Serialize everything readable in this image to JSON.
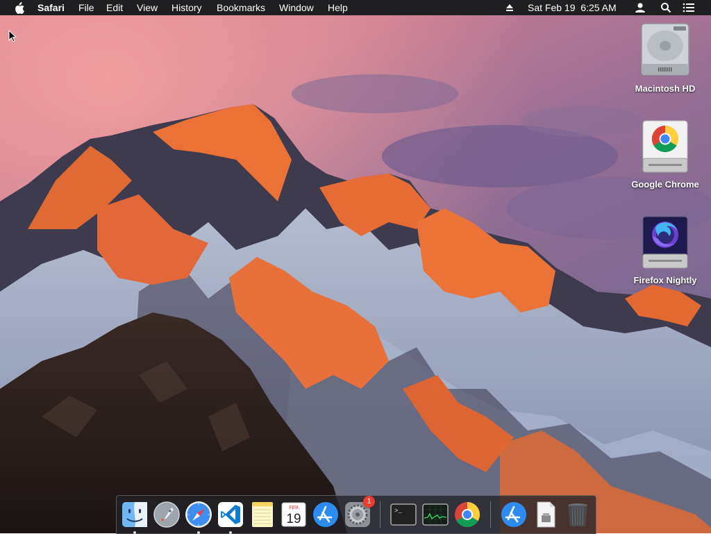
{
  "menubar": {
    "app_name": "Safari",
    "menus": [
      "File",
      "Edit",
      "View",
      "History",
      "Bookmarks",
      "Window",
      "Help"
    ],
    "datetime": "Sat Feb 19  6:25 AM",
    "status_icons": [
      "eject-icon",
      "user-icon",
      "spotlight-search-icon",
      "notification-center-icon"
    ]
  },
  "desktop": {
    "icons": [
      {
        "label": "Macintosh HD",
        "icon": "hard-drive-icon"
      },
      {
        "label": "Google Chrome",
        "icon": "chrome-volume-icon"
      },
      {
        "label": "Firefox Nightly",
        "icon": "firefox-nightly-volume-icon"
      }
    ]
  },
  "dock": {
    "apps": [
      {
        "name": "Finder",
        "icon": "finder-icon",
        "running": true
      },
      {
        "name": "Launchpad",
        "icon": "launchpad-icon",
        "running": false
      },
      {
        "name": "Safari",
        "icon": "safari-icon",
        "running": true
      },
      {
        "name": "Visual Studio Code",
        "icon": "vscode-icon",
        "running": true
      },
      {
        "name": "Notes",
        "icon": "notes-icon",
        "running": false
      },
      {
        "name": "Calendar",
        "icon": "calendar-icon",
        "running": false,
        "calendar_month": "FEB",
        "calendar_day": "19"
      },
      {
        "name": "App Store",
        "icon": "app-store-icon",
        "running": false
      },
      {
        "name": "System Preferences",
        "icon": "system-preferences-icon",
        "running": false,
        "badge": "1"
      },
      {
        "name": "Terminal",
        "icon": "terminal-icon",
        "running": false,
        "prompt": ">_"
      },
      {
        "name": "Activity Monitor",
        "icon": "activity-monitor-icon",
        "running": false
      },
      {
        "name": "Google Chrome",
        "icon": "chrome-icon",
        "running": false
      },
      {
        "name": "App Store Downloads",
        "icon": "app-store-icon",
        "running": false
      },
      {
        "name": "Documents",
        "icon": "document-icon",
        "running": false
      },
      {
        "name": "Trash",
        "icon": "trash-icon",
        "running": false
      }
    ]
  },
  "colors": {
    "menubar_bg": "#1f1f21",
    "sky_top": "#9d6f90",
    "sky_pink": "#e0828c",
    "peak_glow": "#e66a2c",
    "badge": "#ec3b2f"
  }
}
